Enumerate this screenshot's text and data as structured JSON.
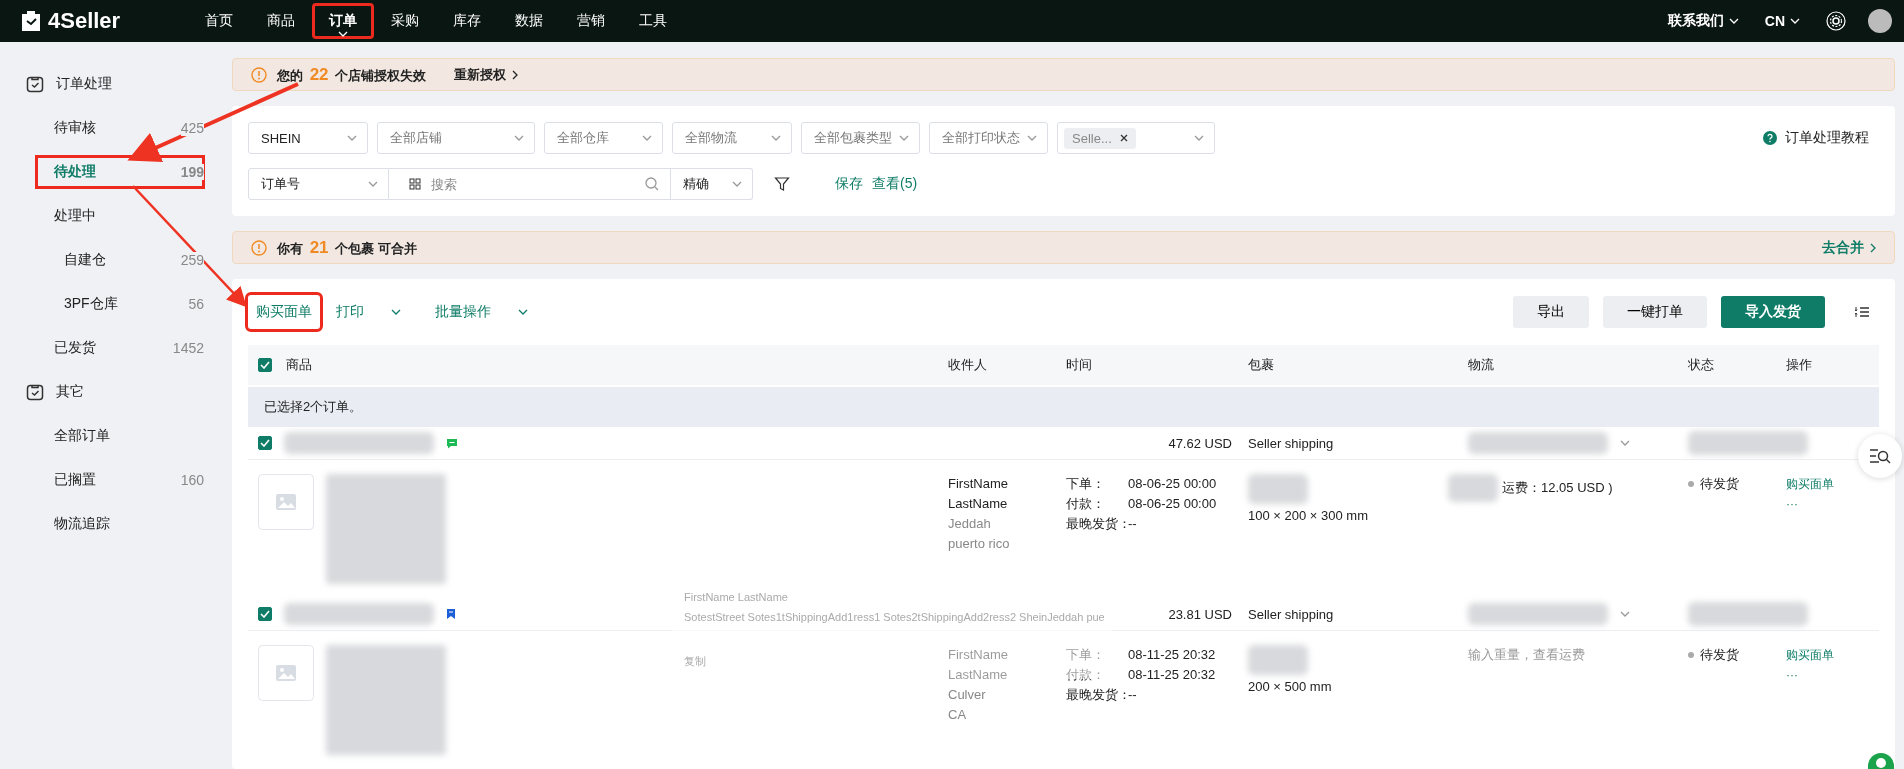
{
  "top_nav": {
    "logo": "4Seller",
    "items": [
      {
        "label": "首页",
        "selected": false,
        "highlighted": false
      },
      {
        "label": "商品",
        "selected": false,
        "highlighted": false
      },
      {
        "label": "订单",
        "selected": true,
        "highlighted": true
      },
      {
        "label": "采购",
        "selected": false,
        "highlighted": false
      },
      {
        "label": "库存",
        "selected": false,
        "highlighted": false
      },
      {
        "label": "数据",
        "selected": false,
        "highlighted": false
      },
      {
        "label": "营销",
        "selected": false,
        "highlighted": false
      },
      {
        "label": "工具",
        "selected": false,
        "highlighted": false
      }
    ],
    "contact": "联系我们",
    "language": "CN"
  },
  "sidebar": {
    "groups": [
      {
        "title": "订单处理",
        "items": [
          {
            "label": "待审核",
            "count": "425",
            "selected": false,
            "highlighted": false
          },
          {
            "label": "待处理",
            "count": "199",
            "selected": true,
            "highlighted": true
          },
          {
            "label": "处理中",
            "selected": false,
            "highlighted": false,
            "children": [
              {
                "label": "自建仓",
                "count": "259",
                "selected": false,
                "highlighted": false
              },
              {
                "label": "3PF仓库",
                "count": "56",
                "selected": false,
                "highlighted": false
              }
            ]
          },
          {
            "label": "已发货",
            "count": "1452",
            "selected": false,
            "highlighted": false
          }
        ]
      },
      {
        "title": "其它",
        "items": [
          {
            "label": "全部订单",
            "selected": false,
            "highlighted": false
          },
          {
            "label": "已搁置",
            "count": "160",
            "selected": false,
            "highlighted": false
          },
          {
            "label": "物流追踪",
            "selected": false,
            "highlighted": false
          }
        ]
      }
    ]
  },
  "auth_alert": {
    "before": "您的",
    "count": "22",
    "after": "个店铺授权失效",
    "link": "重新授权"
  },
  "filters": {
    "selects": [
      {
        "kind": "value",
        "text": "SHEIN"
      },
      {
        "kind": "placeholder",
        "text": "全部店铺"
      },
      {
        "kind": "placeholder",
        "text": "全部仓库"
      },
      {
        "kind": "placeholder",
        "text": "全部物流"
      },
      {
        "kind": "placeholder",
        "text": "全部包裹类型"
      },
      {
        "kind": "placeholder",
        "text": "全部打印状态"
      },
      {
        "kind": "tags",
        "text": "Selle..."
      }
    ],
    "search_type": "订单号",
    "search_placeholder": "搜索",
    "match": "精确",
    "save": "保存",
    "view": "查看(5)",
    "tutorial": "订单处理教程"
  },
  "merge_alert": {
    "before": "你有",
    "count": "21",
    "after": "个包裹 可合并",
    "link": "去合并"
  },
  "toolbar": {
    "actions": [
      {
        "label": "购买面单",
        "dropdown": false,
        "highlighted": true
      },
      {
        "label": "打印",
        "dropdown": true,
        "highlighted": false
      },
      {
        "label": "批量操作",
        "dropdown": true,
        "highlighted": false
      }
    ],
    "buttons": [
      {
        "label": "导出",
        "primary": false
      },
      {
        "label": "一键打单",
        "primary": false
      },
      {
        "label": "导入发货",
        "primary": true
      }
    ]
  },
  "table": {
    "all_checked": true,
    "columns": [
      "商品",
      "收件人",
      "时间",
      "包裹",
      "物流",
      "状态",
      "操作"
    ],
    "selection_note": "已选择2个订单。",
    "orders": [
      {
        "checked": true,
        "kind": "chat",
        "amount": "47.62 USD",
        "shipping": "Seller shipping",
        "recipient": {
          "first": "FirstName",
          "last": "LastName",
          "city": "Jeddah",
          "region": "puerto rico"
        },
        "times": [
          {
            "label": "下单：",
            "value": "08-06-25 00:00"
          },
          {
            "label": "付款：",
            "value": "08-06-25 00:00"
          },
          {
            "label": "最晚发货：",
            "value": "--"
          }
        ],
        "package_size": "100 × 200 × 300 mm",
        "logistics": {
          "kind": "fee",
          "text": "运费：12.05 USD )"
        },
        "status": "待发货",
        "actions": [
          "购买面单",
          "···"
        ]
      },
      {
        "checked": true,
        "kind": "bookmark",
        "amount": "23.81 USD",
        "shipping": "Seller shipping",
        "recipient": {
          "first": "FirstName",
          "last": "LastName",
          "city": "Culver",
          "region": "CA"
        },
        "times": [
          {
            "label": "下单：",
            "value": "08-11-25 20:32"
          },
          {
            "label": "付款：",
            "value": "08-11-25 20:32"
          },
          {
            "label": "最晚发货：",
            "value": "--"
          }
        ],
        "package_size": "200 × 500 mm",
        "logistics": {
          "kind": "hint",
          "text": "输入重量，查看运费"
        },
        "status": "待发货",
        "actions": [
          "购买面单",
          "···"
        ]
      }
    ]
  },
  "address_tooltip": {
    "name": "FirstName LastName",
    "address": "SotestStreet Sotes1tShippingAdd1ress1 Sotes2tShippingAdd2ress2 SheinJeddah pue",
    "copy": "复制"
  }
}
